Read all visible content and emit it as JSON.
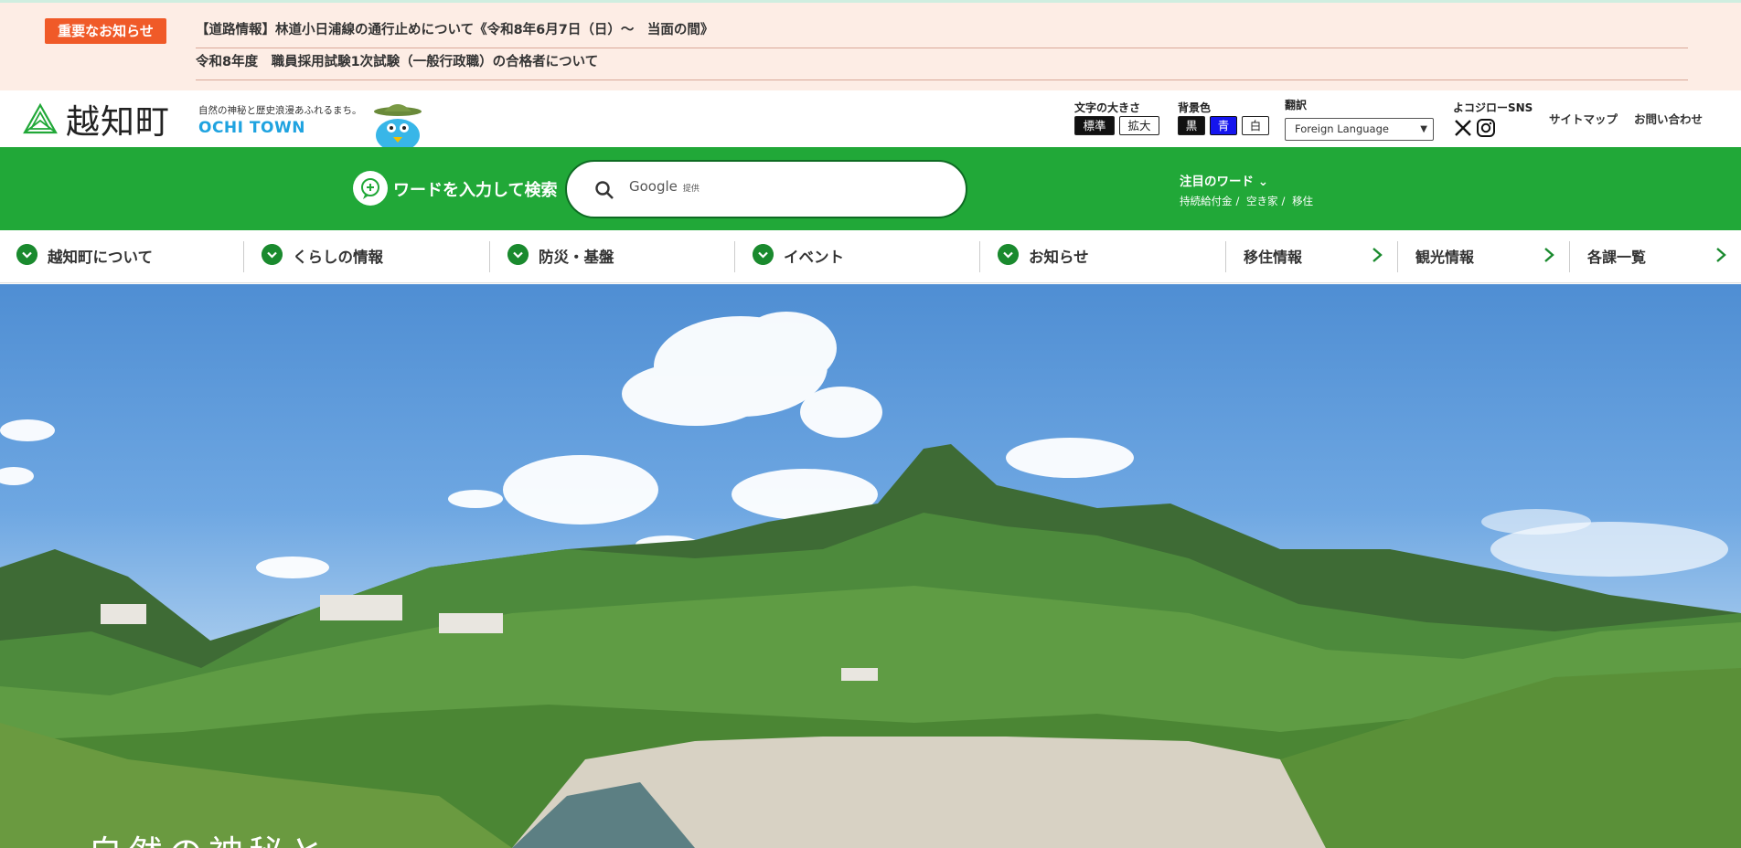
{
  "notice": {
    "badge": "重要なお知らせ",
    "items": [
      "【道路情報】林道小日浦線の通行止めについて《令和8年6月7日（日）〜　当面の間》",
      "令和8年度　職員採用試験1次試験（一般行政職）の合格者について"
    ]
  },
  "header": {
    "logo_name": "越知町",
    "tagline": "自然の神秘と歴史浪漫あふれるまち。",
    "town_en": "OCHI TOWN",
    "font_size": {
      "label": "文字の大きさ",
      "standard": "標準",
      "large": "拡大"
    },
    "bg_color": {
      "label": "背景色",
      "black": "黒",
      "blue": "青",
      "white": "白"
    },
    "translate": {
      "label": "翻訳",
      "selected": "Foreign Language"
    },
    "sns": {
      "label": "よコジローSNS",
      "icons": [
        "x-icon",
        "instagram-icon"
      ]
    },
    "links": {
      "sitemap": "サイトマップ",
      "contact": "お問い合わせ"
    }
  },
  "search": {
    "label": "ワードを入力して検索",
    "placeholder": "Google",
    "provided": "提供",
    "keywords_title": "注目のワード",
    "keywords": [
      "持続給付金",
      "空き家",
      "移住"
    ]
  },
  "nav": {
    "items": [
      "越知町について",
      "くらしの情報",
      "防災・基盤",
      "イベント",
      "お知らせ"
    ],
    "links": [
      "移住情報",
      "観光情報",
      "各課一覧"
    ]
  },
  "hero": {
    "caption": "自然の神秘と"
  },
  "colors": {
    "accent_green": "#21a838",
    "notice_bg": "#fdede5",
    "badge": "#f05a28",
    "town_blue": "#1fa3e0"
  }
}
